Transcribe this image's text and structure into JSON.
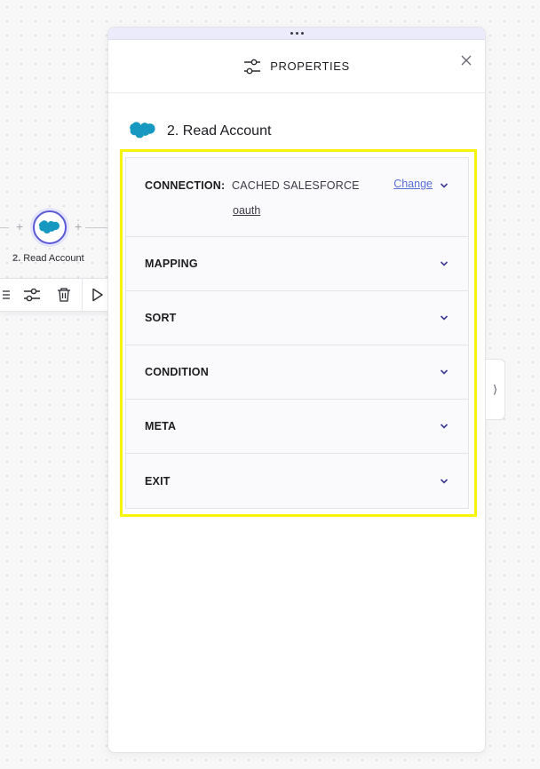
{
  "canvas": {
    "node": {
      "number": "2.",
      "label": "Read Account",
      "icon": "salesforce-icon"
    },
    "toolbar": {
      "icons": [
        "list-icon",
        "sliders-icon",
        "trash-icon",
        "play-icon"
      ]
    }
  },
  "panel": {
    "header_title": "PROPERTIES",
    "header_icon": "sliders-icon",
    "step_title": "2. Read Account",
    "sections": {
      "connection": {
        "label": "CONNECTION:",
        "value": "CACHED SALESFORCE",
        "auth": "oauth",
        "change_label": "Change"
      },
      "mapping": {
        "label": "MAPPING"
      },
      "sort": {
        "label": "SORT"
      },
      "condition": {
        "label": "CONDITION"
      },
      "meta": {
        "label": "META"
      },
      "exit": {
        "label": "EXIT"
      }
    },
    "side_tab_glyph": "⟩"
  },
  "colors": {
    "accent": "#5a59d8",
    "link": "#5a6fd8",
    "highlight": "#f7f30b",
    "salesforce": "#1798c1"
  }
}
